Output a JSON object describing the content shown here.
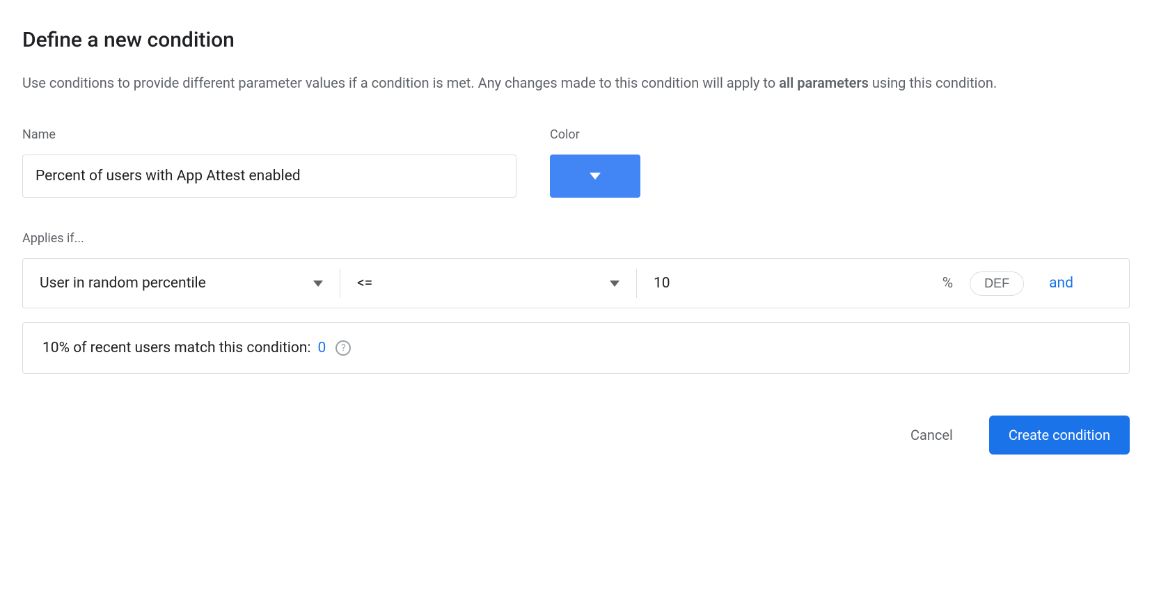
{
  "title": "Define a new condition",
  "description": {
    "prefix": "Use conditions to provide different parameter values if a condition is met. Any changes made to this condition will apply to ",
    "bold": "all parameters",
    "suffix": " using this condition."
  },
  "fields": {
    "name_label": "Name",
    "name_value": "Percent of users with App Attest enabled",
    "color_label": "Color",
    "color_value": "#4285f4"
  },
  "applies": {
    "label": "Applies if...",
    "condition_type": "User in random percentile",
    "operator": "<=",
    "value": "10",
    "unit": "%",
    "seed_chip": "DEF",
    "and_label": "and"
  },
  "match": {
    "text": "10% of recent users match this condition: ",
    "count": "0"
  },
  "buttons": {
    "cancel": "Cancel",
    "create": "Create condition"
  }
}
